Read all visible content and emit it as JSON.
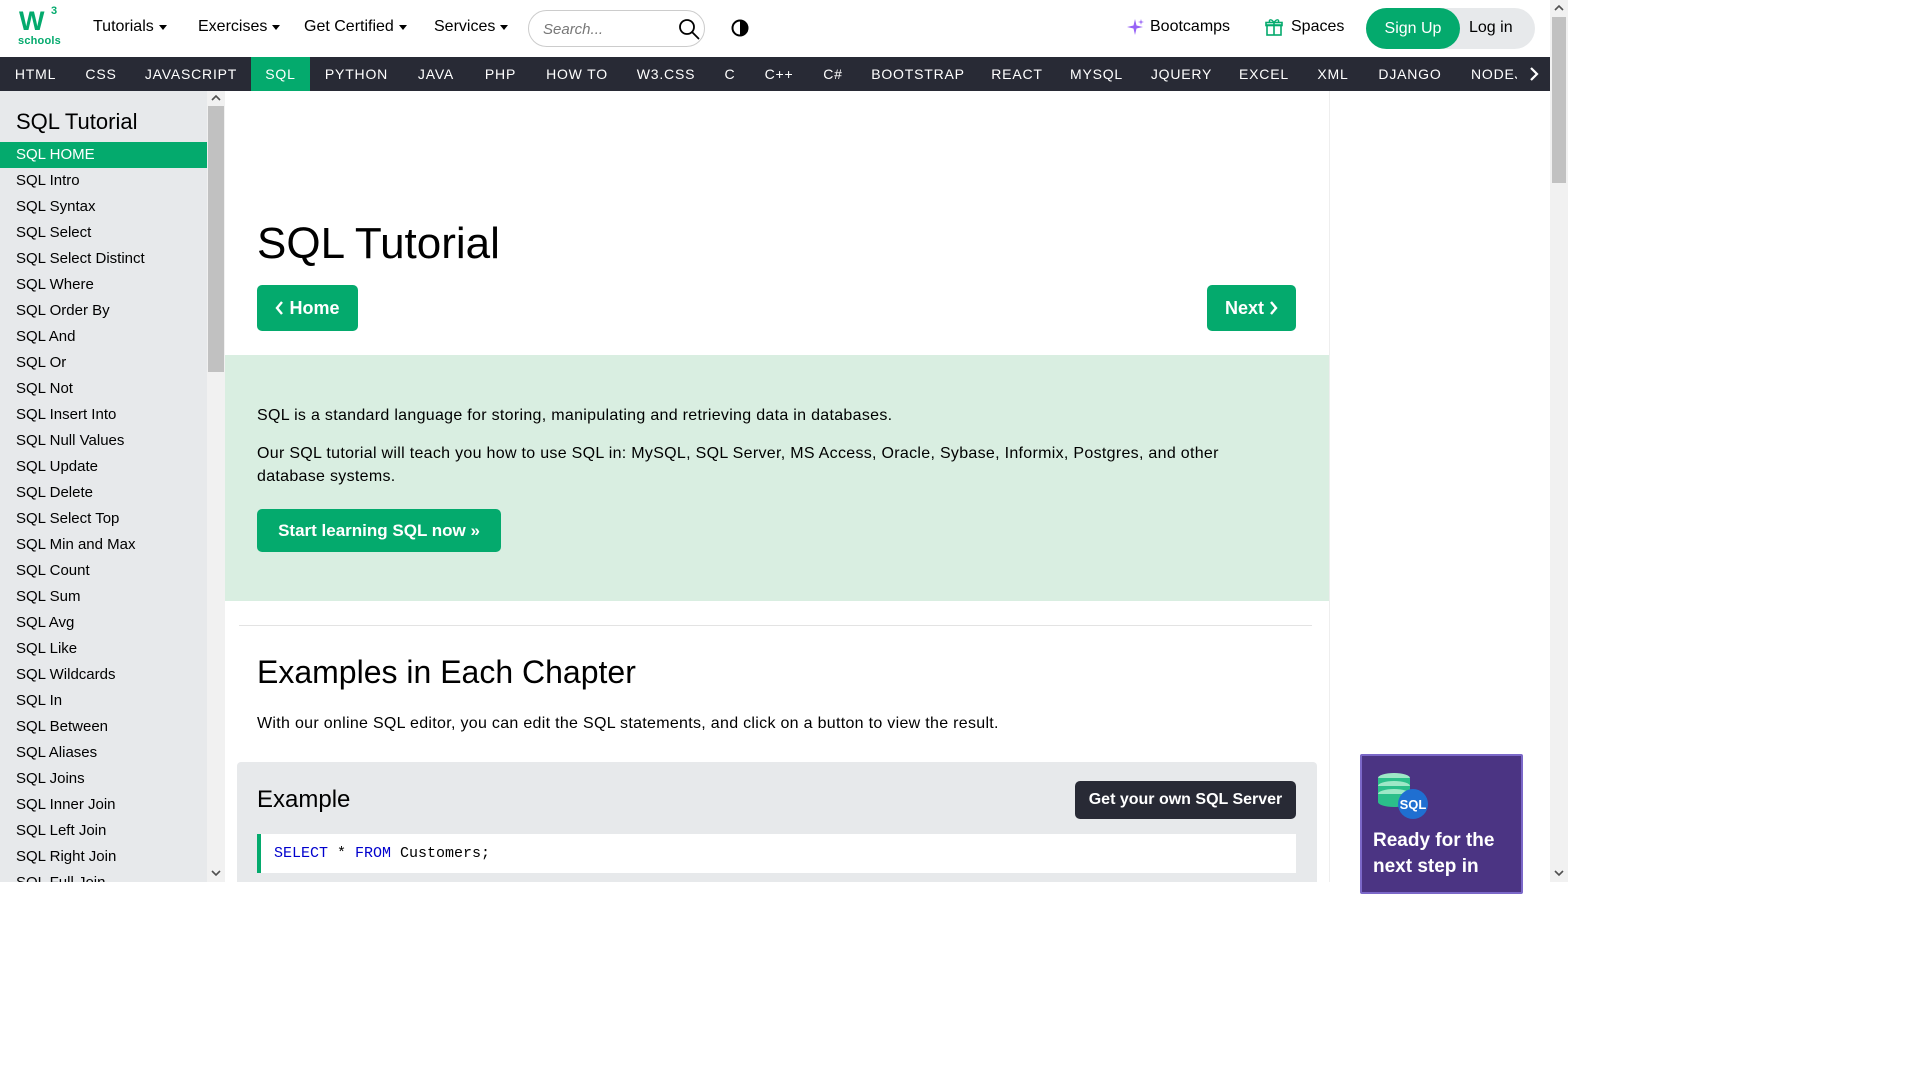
{
  "header": {
    "logo_text": "W",
    "logo_sup": "3",
    "logo_sub": "schools",
    "menus": [
      "Tutorials",
      "Exercises",
      "Get Certified",
      "Services"
    ],
    "search_placeholder": "Search...",
    "bootcamps_label": "Bootcamps",
    "spaces_label": "Spaces",
    "signup_label": "Sign Up",
    "login_label": "Log in"
  },
  "langnav": {
    "items": [
      "HTML",
      "CSS",
      "JAVASCRIPT",
      "SQL",
      "PYTHON",
      "JAVA",
      "PHP",
      "HOW TO",
      "W3.CSS",
      "C",
      "C++",
      "C#",
      "BOOTSTRAP",
      "REACT",
      "MYSQL",
      "JQUERY",
      "EXCEL",
      "XML",
      "DJANGO",
      "NODEJS"
    ],
    "active": "SQL"
  },
  "sidebar": {
    "title": "SQL Tutorial",
    "items": [
      "SQL HOME",
      "SQL Intro",
      "SQL Syntax",
      "SQL Select",
      "SQL Select Distinct",
      "SQL Where",
      "SQL Order By",
      "SQL And",
      "SQL Or",
      "SQL Not",
      "SQL Insert Into",
      "SQL Null Values",
      "SQL Update",
      "SQL Delete",
      "SQL Select Top",
      "SQL Min and Max",
      "SQL Count",
      "SQL Sum",
      "SQL Avg",
      "SQL Like",
      "SQL Wildcards",
      "SQL In",
      "SQL Between",
      "SQL Aliases",
      "SQL Joins",
      "SQL Inner Join",
      "SQL Left Join",
      "SQL Right Join",
      "SQL Full Join"
    ],
    "active": "SQL HOME"
  },
  "main": {
    "title": "SQL Tutorial",
    "home_button": "Home",
    "next_button": "Next",
    "intro_p1": "SQL is a standard language for storing, manipulating and retrieving data in databases.",
    "intro_p2a": "Our SQL tutorial will teach you how to use SQL in: MySQL, SQL Server, MS Access, Oracle, Sybase, Informix, Postgres, and other",
    "intro_p2b": "database systems.",
    "start_button": "Start learning SQL now »",
    "examples_title": "Examples in Each Chapter",
    "examples_text": "With our online SQL editor, you can edit the SQL statements, and click on a button to view the result.",
    "example_title": "Example",
    "sqlserver_button": "Get your own SQL Server",
    "code": {
      "kw1": "SELECT",
      "mid": " * ",
      "kw2": "FROM",
      "rest": " Customers;"
    }
  },
  "ad": {
    "icon_label": "SQL",
    "text_line1": "Ready for the",
    "text_line2": "next step in"
  },
  "colors": {
    "accent": "#04AA6D",
    "nav_bg": "#282A35",
    "sidebar_bg": "#E7E9EB",
    "intro_bg": "#D9EEE1",
    "ad_bg": "#4B3483"
  }
}
